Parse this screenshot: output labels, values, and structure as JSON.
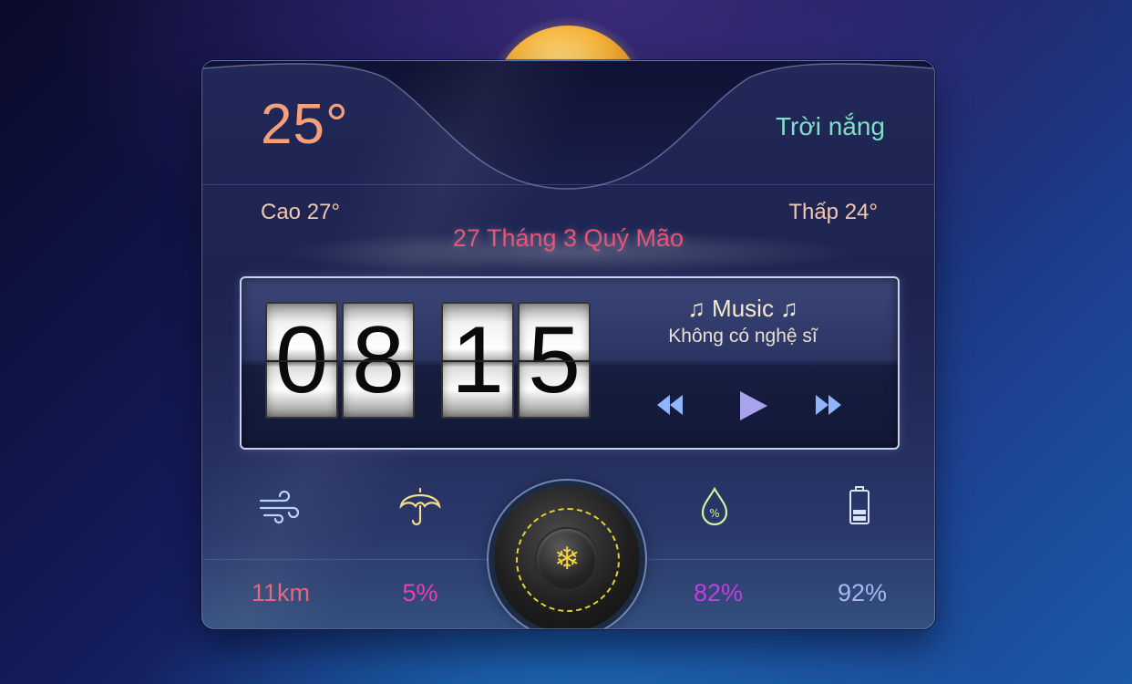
{
  "weather": {
    "temperature": "25°",
    "condition": "Trời nắng",
    "high": "Cao 27°",
    "low": "Thấp 24°",
    "icon": "sun-cloud-icon"
  },
  "lunar_date": "27 Tháng 3 Quý Mão",
  "clock": {
    "hour_tens": "0",
    "hour_ones": "8",
    "minute_tens": "1",
    "minute_ones": "5"
  },
  "music": {
    "title": "♫ Music ♫",
    "artist": "Không có nghệ sĩ",
    "controls": [
      "rewind-icon",
      "play-icon",
      "fast-forward-icon"
    ]
  },
  "stats": [
    {
      "icon": "wind-icon",
      "value": "11km",
      "color": "#e8677c"
    },
    {
      "icon": "umbrella-icon",
      "value": "5%",
      "color": "#e63fb0"
    },
    {
      "icon": "humidity-drop-icon",
      "value": "82%",
      "color": "#c23ee0"
    },
    {
      "icon": "battery-icon",
      "value": "92%",
      "color": "#a9b8f0"
    }
  ],
  "dial": {
    "icon": "snowflake-icon"
  },
  "colors": {
    "temperature": "#f4a079",
    "condition": "#7fe0c8",
    "lunar": "#e9527a",
    "controls": "#8fb6ff"
  }
}
